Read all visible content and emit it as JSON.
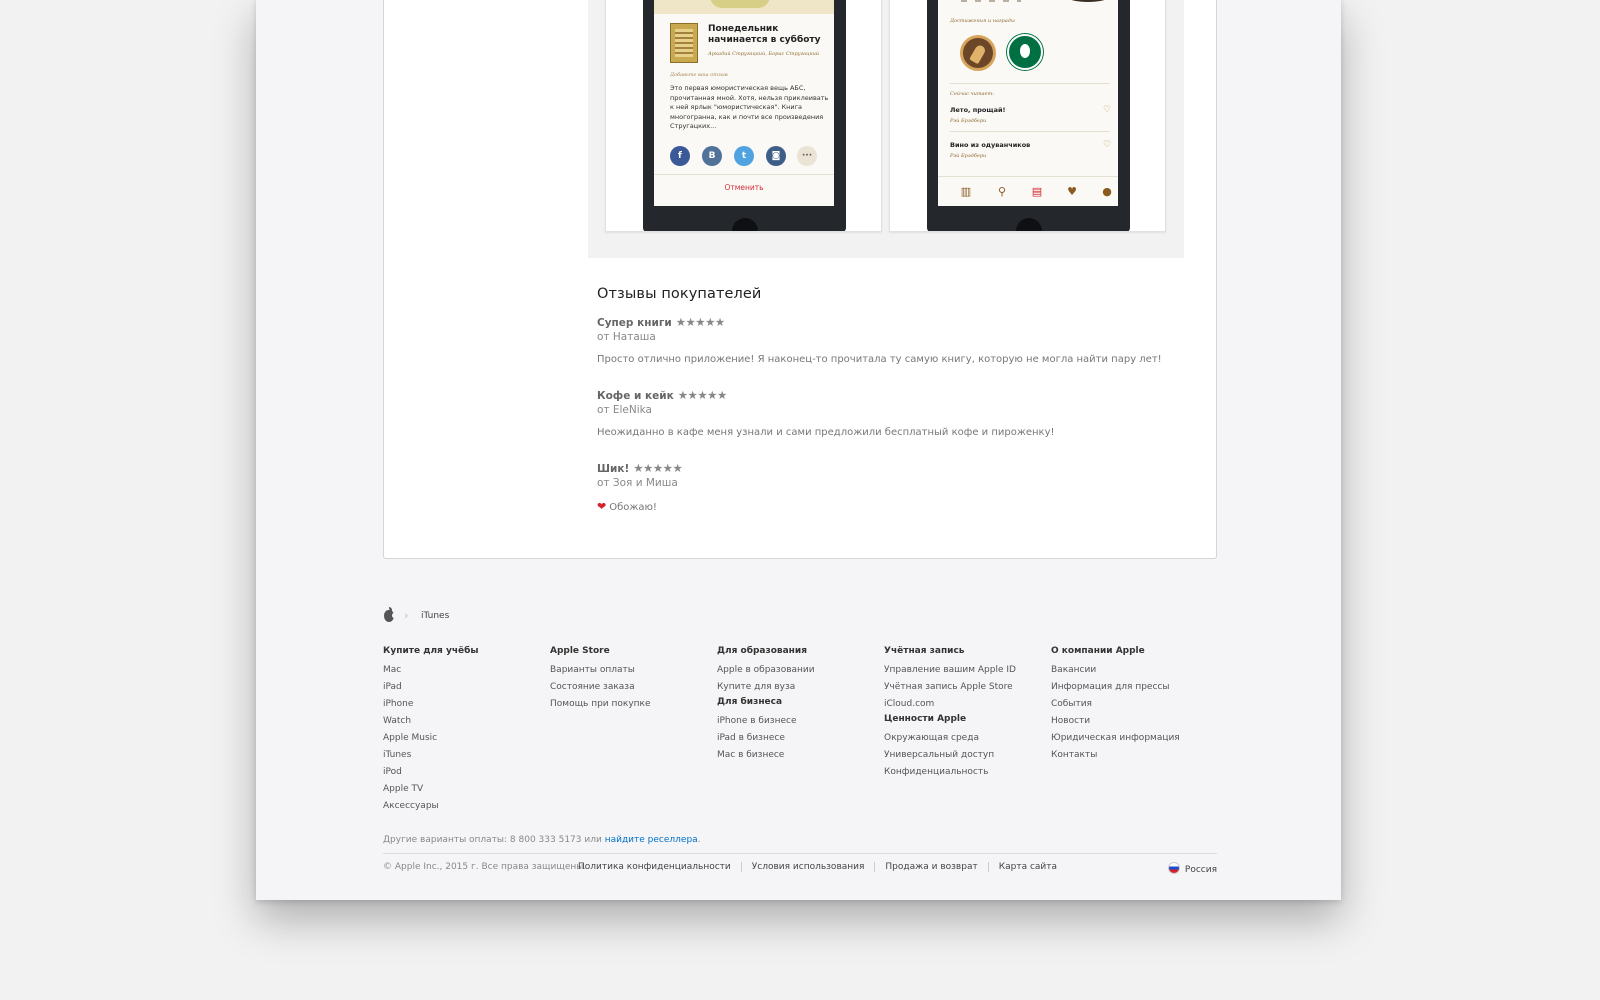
{
  "screenshots": {
    "share_sheet": {
      "book_title": "Понедельник начинается в субботу",
      "book_authors": "Аркадий Стругацкий, Борис Стругацкий",
      "review_hint": "Добавьте ваш отзыв",
      "review_text": "Это первая юмористическая вещь АБС, прочитанная мной. Хотя, нельзя приклеивать к ней ярлык \"юмористическая\". Книга многогранна, как и почти все произведения Стругацких...",
      "share_buttons": [
        {
          "label": "f",
          "icon": "facebook-icon"
        },
        {
          "label": "B",
          "icon": "vk-icon"
        },
        {
          "label": "t",
          "icon": "twitter-icon"
        },
        {
          "label": "◙",
          "icon": "instagram-icon"
        },
        {
          "label": "···",
          "icon": "more-icon"
        }
      ],
      "cancel_label": "Отменить"
    },
    "profile": {
      "achievements_label": "Достижения и награды",
      "reading_label": "Сейчас читает:",
      "reading": [
        {
          "title": "Лето, прощай!",
          "author": "Рэй Брэдбери"
        },
        {
          "title": "Вино из одуванчиков",
          "author": "Рэй Брэдбери"
        }
      ]
    }
  },
  "reviews": {
    "heading": "Отзывы покупателей",
    "items": [
      {
        "title": "Супер книги",
        "stars": "★★★★★",
        "author": "от Наташа",
        "body": "Просто отлично приложение! Я наконец-то прочитала ту самую книгу, которую не могла найти пару лет!"
      },
      {
        "title": "Кофе и кейк",
        "stars": "★★★★★",
        "author": "от EleNika",
        "body": "Неожиданно в кафе меня узнали и сами предложили бесплатный кофе и пироженку!"
      },
      {
        "title": "Шик!",
        "stars": "★★★★★",
        "author": "от Зоя и Миша",
        "body": "Обожаю!",
        "emoji": "❤"
      }
    ]
  },
  "footer": {
    "breadcrumb": "iTunes",
    "columns": [
      {
        "sections": [
          {
            "heading": "Купите для учёбы",
            "links": [
              "Mac",
              "iPad",
              "iPhone",
              "Watch",
              "Apple Music",
              "iTunes",
              "iPod",
              "Apple TV",
              "Аксессуары"
            ]
          }
        ]
      },
      {
        "sections": [
          {
            "heading": "Apple Store",
            "links": [
              "Варианты оплаты",
              "Состояние заказа",
              "Помощь при покупке"
            ]
          }
        ]
      },
      {
        "sections": [
          {
            "heading": "Для образования",
            "links": [
              "Apple в образовании",
              "Купите для вуза"
            ]
          },
          {
            "heading": "Для бизнеса",
            "links": [
              "iPhone в бизнесе",
              "iPad в бизнесе",
              "Mac в бизнесе"
            ]
          }
        ]
      },
      {
        "sections": [
          {
            "heading": "Учётная запись",
            "links": [
              "Управление вашим Apple ID",
              "Учётная запись Apple Store",
              "iCloud.com"
            ]
          },
          {
            "heading": "Ценности Apple",
            "links": [
              "Окружающая среда",
              "Универсальный доступ",
              "Конфиденциальность"
            ]
          }
        ]
      },
      {
        "sections": [
          {
            "heading": "О компании Apple",
            "links": [
              "Вакансии",
              "Информация для прессы",
              "События",
              "Новости",
              "Юридическая информация",
              "Контакты"
            ]
          }
        ]
      }
    ],
    "payment_note": "Другие варианты оплаты: 8 800 333 5173 или",
    "payment_link": "найдите реселлера",
    "payment_end": ".",
    "copyright": "© Apple Inc., 2015 г. Все права защищены.",
    "legal_links": [
      "Политика конфиденциальности",
      "Условия использования",
      "Продажа и возврат",
      "Карта сайта"
    ],
    "country": "Россия"
  }
}
